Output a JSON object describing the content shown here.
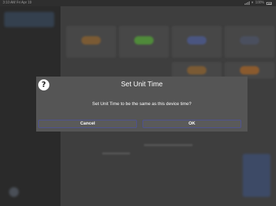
{
  "status_bar": {
    "time_date": "3:10 AM   Fri Apr 19",
    "battery": "100%",
    "signal_icon": "signal-icon",
    "wifi_icon": "wifi-icon",
    "battery_icon": "battery-icon"
  },
  "dialog": {
    "icon": "help-icon",
    "icon_glyph": "?",
    "title": "Set Unit Time",
    "message": "Set Unit Time to be the same as this device time?",
    "cancel_label": "Cancel",
    "ok_label": "OK"
  },
  "colors": {
    "dialog_background": "#555555",
    "button_border": "#4d5294",
    "overlay": "#3b3b3b"
  }
}
